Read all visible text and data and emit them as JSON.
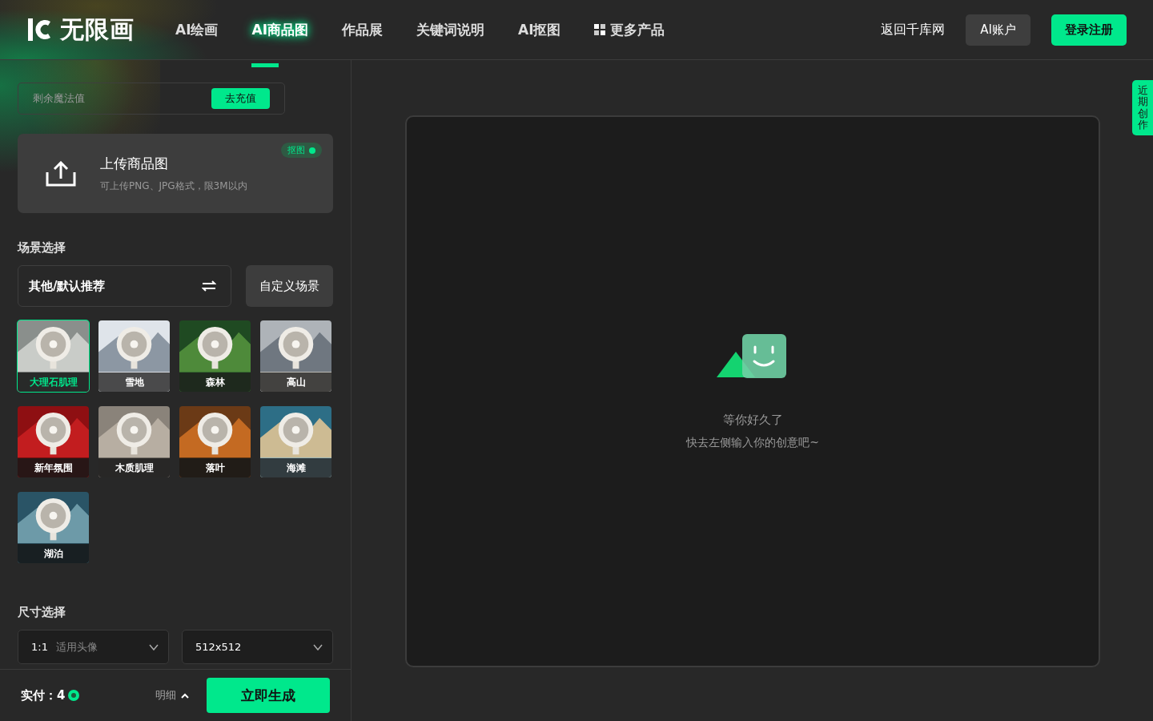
{
  "header": {
    "logo": "无限画",
    "nav": [
      {
        "label": "AI绘画",
        "selected": false,
        "kind": "link"
      },
      {
        "label": "AI商品图",
        "selected": true,
        "kind": "link"
      },
      {
        "label": "作品展",
        "selected": false,
        "kind": "link"
      },
      {
        "label": "关键词说明",
        "selected": false,
        "kind": "link"
      },
      {
        "label": "AI抠图",
        "selected": false,
        "kind": "link"
      },
      {
        "label": "更多产品",
        "selected": false,
        "kind": "grid"
      }
    ],
    "back_link": "返回千库网",
    "account_button": "AI账户",
    "login_button": "登录注册"
  },
  "magic": {
    "label": "剩余魔法值",
    "button": "去充值"
  },
  "upload": {
    "title": "上传商品图",
    "hint": "可上传PNG、JPG格式，限3M以内",
    "badge": "抠图",
    "badge_on": true
  },
  "scene": {
    "heading": "场景选择",
    "select": "其他/默认推荐",
    "custom_button": "自定义场景",
    "tiles": [
      {
        "label": "大理石肌理",
        "selected": true
      },
      {
        "label": "雪地",
        "selected": false
      },
      {
        "label": "森林",
        "selected": false
      },
      {
        "label": "高山",
        "selected": false
      },
      {
        "label": "新年氛围",
        "selected": false
      },
      {
        "label": "木质肌理",
        "selected": false
      },
      {
        "label": "落叶",
        "selected": false
      },
      {
        "label": "海滩",
        "selected": false
      },
      {
        "label": "湖泊",
        "selected": false
      }
    ]
  },
  "size": {
    "heading": "尺寸选择",
    "ratio": "1:1",
    "ratio_hint": "适用头像",
    "resolution": "512x512"
  },
  "footer": {
    "price_label": "实付：",
    "price": "4",
    "detail": "明细",
    "generate_button": "立即生成"
  },
  "canvas": {
    "line_1": "等你好久了",
    "line_2": "快去左侧输入你的创意吧~"
  },
  "side_tab": "近期创作"
}
